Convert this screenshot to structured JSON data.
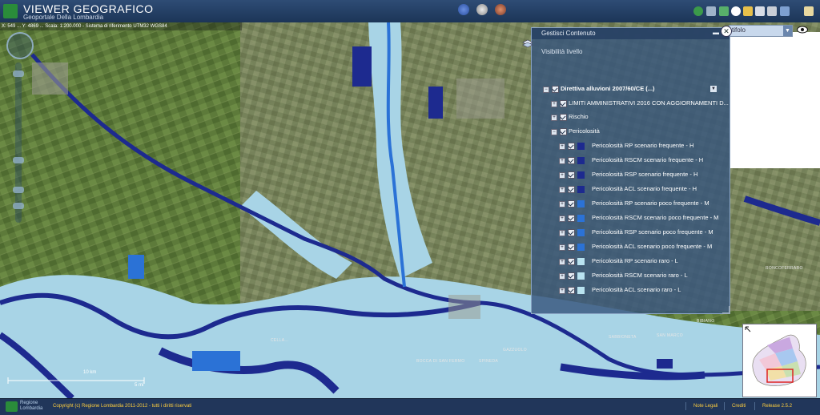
{
  "header": {
    "title": "VIEWER GEOGRAFICO",
    "subtitle": "Geoportale Della Lombardia"
  },
  "map": {
    "coordinate_readout": "X: 549 ... Y: 4869 ... Scala: 1:200.000 - Sistema di riferimento UTM32 WGS84",
    "layer_search_value": "tifolo",
    "scale": {
      "label_top": "10 km",
      "label_bottom": "5 mi"
    },
    "place_names": [
      "CELLA...",
      "GAZZUOLO",
      "SPINEDA",
      "BOCCA DI SAN FERMO",
      "RONCOFERRARO",
      "SAN MARCO",
      "BIBIANO",
      "SABBIONETA"
    ]
  },
  "content_panel": {
    "title": "Gestisci Contenuto",
    "visibility_label": "Visibilità livello",
    "group": "Direttiva alluvioni 2007/60/CE (...)",
    "subgroups": [
      {
        "label": "LIMITI AMMINISTRATIVI 2016 CON AGGIORNAMENTI D..."
      },
      {
        "label": "Rischio"
      },
      {
        "label": "Pericolosità"
      }
    ],
    "layers": [
      {
        "label": "Pericolosità RP scenario frequente - H",
        "color": "#1d2a8f"
      },
      {
        "label": "Pericolosità RSCM scenario frequente - H",
        "color": "#1d2a8f"
      },
      {
        "label": "Pericolosità RSP scenario frequente - H",
        "color": "#1d2a8f"
      },
      {
        "label": "Pericolosità ACL scenario frequente - H",
        "color": "#1d2a8f"
      },
      {
        "label": "Pericolosità RP scenario poco frequente - M",
        "color": "#2b72d6"
      },
      {
        "label": "Pericolosità RSCM scenario poco frequente - M",
        "color": "#2b72d6"
      },
      {
        "label": "Pericolosità RSP scenario poco frequente - M",
        "color": "#2b72d6"
      },
      {
        "label": "Pericolosità ACL scenario poco frequente - M",
        "color": "#2b72d6"
      },
      {
        "label": "Pericolosità RP scenario raro - L",
        "color": "#b9e3f0"
      },
      {
        "label": "Pericolosità RSCM scenario raro - L",
        "color": "#b9e3f0"
      },
      {
        "label": "Pericolosità ACL scenario raro - L",
        "color": "#b9e3f0"
      }
    ]
  },
  "overview": {
    "province_labels": [
      "SO",
      "LC",
      "CO",
      "BG",
      "BS",
      "VA",
      "MB",
      "MI",
      "CR",
      "MN",
      "LO",
      "PV"
    ]
  },
  "footer": {
    "org_line1": "Regione",
    "org_line2": "Lombardia",
    "copyright": "Copyright (c) Regione Lombardia 2011-2012 - tutti i diritti riservati",
    "note_legali": "Note Legali",
    "crediti": "Crediti",
    "release": "Release 2.5.2"
  },
  "colors": {
    "high_hazard": "#1d2a8f",
    "medium_hazard": "#2b72d6",
    "low_hazard": "#b9e3f0",
    "header_bg": "#2e4c75",
    "footer_link": "#ffcf3f"
  },
  "icons": [
    "app-logo-icon",
    "compass-tool-icon",
    "measure-tool-icon",
    "globe-tool-icon",
    "eye-icon",
    "close-icon",
    "layer-stack-icon"
  ]
}
